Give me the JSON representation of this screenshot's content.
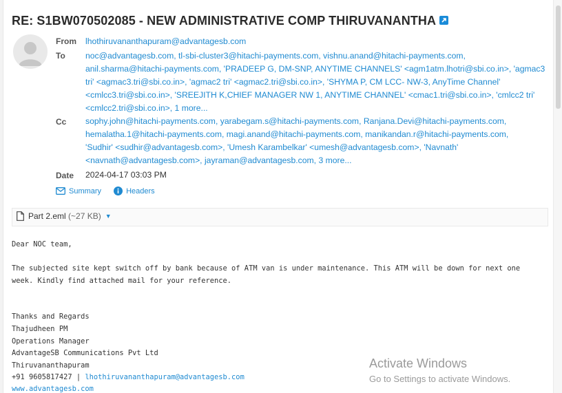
{
  "email": {
    "subject": "RE: S1BW070502085 - NEW ADMINISTRATIVE COMP THIRUVANANTHA",
    "from_label": "From",
    "from": "lhothiruvananthapuram@advantagesb.com",
    "to_label": "To",
    "to_lines": [
      "noc@advantagesb.com, tl-sbi-cluster3@hitachi-payments.com, vishnu.anand@hitachi-payments.com,",
      "anil.sharma@hitachi-payments.com, 'PRADEEP G, DM-SNP, ANYTIME CHANNELS' <agm1atm.lhotri@sbi.co.in>, 'agmac3",
      "tri' <agmac3.tri@sbi.co.in>, 'agmac2 tri' <agmac2.tri@sbi.co.in>, 'SHYMA P, CM LCC- NW-3, AnyTime Channel'",
      "<cmlcc3.tri@sbi.co.in>, 'SREEJITH K,CHIEF MANAGER NW 1, ANYTIME CHANNEL' <cmac1.tri@sbi.co.in>, 'cmlcc2 tri'",
      "<cmlcc2.tri@sbi.co.in>, "
    ],
    "to_more": "1 more...",
    "cc_label": "Cc",
    "cc_lines": [
      "sophy.john@hitachi-payments.com, yarabegam.s@hitachi-payments.com, Ranjana.Devi@hitachi-payments.com,",
      "hemalatha.1@hitachi-payments.com, magi.anand@hitachi-payments.com, manikandan.r@hitachi-payments.com,",
      "'Sudhir' <sudhir@advantagesb.com>, 'Umesh Karambelkar' <umesh@advantagesb.com>, 'Navnath'",
      "<navnath@advantagesb.com>, jayraman@advantagesb.com, "
    ],
    "cc_more": "3 more...",
    "date_label": "Date",
    "date": "2024-04-17 03:03 PM"
  },
  "actions": {
    "summary": "Summary",
    "headers": "Headers"
  },
  "attachment": {
    "name": "Part 2.eml",
    "size": "(~27 KB)"
  },
  "body": {
    "greeting": "Dear NOC team,",
    "line1": "The subjected site kept switch off by bank because of ATM van is under maintenance. This ATM will be down for next one",
    "line2": "week. Kindly find attached mail for your reference.",
    "sig1": "Thanks and Regards",
    "sig2": "Thajudheen PM",
    "sig3": "Operations Manager",
    "sig4": "AdvantageSB Communications Pvt Ltd",
    "sig5": "Thiruvananthapuram",
    "phone": "+91 9605817427 | ",
    "sig_email": "lhothiruvananthapuram@advantagesb.com",
    "website": "www.advantagesb.com"
  },
  "watermark": {
    "title": "Activate Windows",
    "subtitle": "Go to Settings to activate Windows."
  }
}
